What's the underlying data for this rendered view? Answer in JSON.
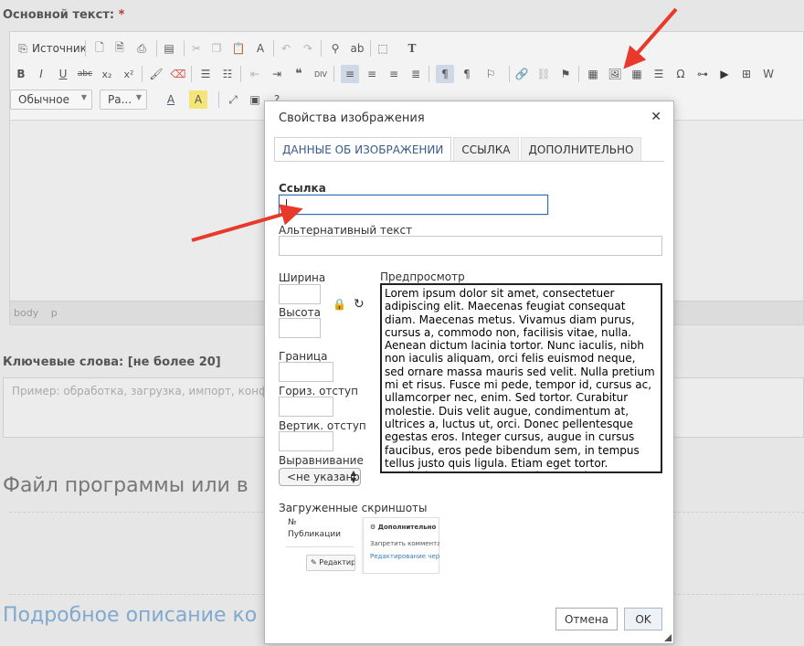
{
  "form": {
    "main_text_label": "Основной текст:",
    "required_mark": "*",
    "keywords_label": "Ключевые слова: [не более 20]",
    "keywords_placeholder": "Пример: обработка, загрузка, импорт, конфиг",
    "file_heading": "Файл программы или в",
    "description_heading": "Подробное описание ко"
  },
  "editor": {
    "source_label": "Источник",
    "format_combo": "Обычное",
    "font_combo": "Ра...",
    "path": [
      "body",
      "p"
    ],
    "toolbar_icons": [
      "source-icon",
      "new-page-icon",
      "print-icon",
      "templates-icon",
      "cut-icon",
      "copy-icon",
      "paste-icon",
      "paste-text-icon",
      "undo-icon",
      "redo-icon",
      "find-icon",
      "replace-icon",
      "select-all-icon",
      "format-icon",
      "bold-icon",
      "italic-icon",
      "underline-icon",
      "strike-icon",
      "subscript-icon",
      "superscript-icon",
      "copy-format-icon",
      "remove-format-icon",
      "numbered-list-icon",
      "bulleted-list-icon",
      "outdent-icon",
      "indent-icon",
      "blockquote-icon",
      "div-icon",
      "align-left-icon",
      "align-center-icon",
      "align-right-icon",
      "justify-icon",
      "ltr-icon",
      "rtl-icon",
      "language-icon",
      "link-icon",
      "unlink-icon",
      "anchor-icon",
      "iframe-icon",
      "image-icon",
      "table-icon",
      "hr-icon",
      "special-char-icon",
      "page-break-icon",
      "youtube-icon",
      "add-icon",
      "paste-word-icon",
      "font-color-icon",
      "bg-color-icon",
      "maximize-icon",
      "show-blocks-icon",
      "help-icon"
    ]
  },
  "dialog": {
    "title": "Свойства изображения",
    "tabs": [
      {
        "label": "Данные об изображении",
        "active": true
      },
      {
        "label": "Ссылка",
        "active": false
      },
      {
        "label": "Дополнительно",
        "active": false
      }
    ],
    "url_label": "Ссылка",
    "url_value": "",
    "alt_label": "Альтернативный текст",
    "alt_value": "",
    "width_label": "Ширина",
    "height_label": "Высота",
    "border_label": "Граница",
    "hspace_label": "Гориз. отступ",
    "vspace_label": "Вертик. отступ",
    "align_label": "Выравнивание",
    "align_value": "<не указано>",
    "preview_label": "Предпросмотр",
    "preview_text": "Lorem ipsum dolor sit amet, consectetuer adipiscing elit. Maecenas feugiat consequat diam. Maecenas metus. Vivamus diam purus, cursus a, commodo non, facilisis vitae, nulla. Aenean dictum lacinia tortor. Nunc iaculis, nibh non iaculis aliquam, orci felis euismod neque, sed ornare massa mauris sed velit. Nulla pretium mi et risus. Fusce mi pede, tempor id, cursus ac, ullamcorper nec, enim. Sed tortor. Curabitur molestie. Duis velit augue, condimentum at, ultrices a, luctus ut, orci. Donec pellentesque egestas eros. Integer cursus, augue in cursus faucibus, eros pede bibendum sem, in tempus tellus justo quis ligula. Etiam eget tortor. Vestibulum rutrum, est ut placerat elementum, lectus nisl aliquam velit, tempor aliquam eros nunc nonummy metus. In eros metus, gravida a, gravida sed, lobortis id, turpis. Ut",
    "screenshots_label": "Загруженные скриншоты",
    "thumb1": {
      "line1": "№",
      "line2": "Публикации",
      "button": "✎ Редактир"
    },
    "thumb2": {
      "title": "⚙ Дополнительно",
      "line1": "Запретить комментар",
      "link": "Редактирование черно"
    },
    "cancel_label": "Отмена",
    "ok_label": "OK"
  },
  "colors": {
    "accent": "#3a5b87",
    "focus_border": "#346fb6",
    "annotation_arrow": "#e8392b",
    "link_heading": "#7fa9cf"
  }
}
